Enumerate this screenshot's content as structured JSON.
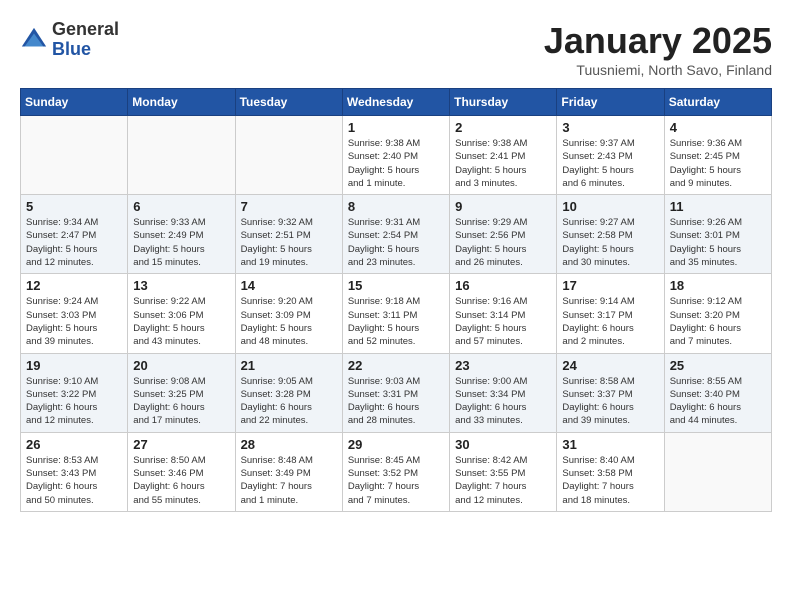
{
  "logo": {
    "general": "General",
    "blue": "Blue"
  },
  "title": "January 2025",
  "subtitle": "Tuusniemi, North Savo, Finland",
  "weekdays": [
    "Sunday",
    "Monday",
    "Tuesday",
    "Wednesday",
    "Thursday",
    "Friday",
    "Saturday"
  ],
  "weeks": [
    [
      {
        "day": "",
        "info": ""
      },
      {
        "day": "",
        "info": ""
      },
      {
        "day": "",
        "info": ""
      },
      {
        "day": "1",
        "info": "Sunrise: 9:38 AM\nSunset: 2:40 PM\nDaylight: 5 hours\nand 1 minute."
      },
      {
        "day": "2",
        "info": "Sunrise: 9:38 AM\nSunset: 2:41 PM\nDaylight: 5 hours\nand 3 minutes."
      },
      {
        "day": "3",
        "info": "Sunrise: 9:37 AM\nSunset: 2:43 PM\nDaylight: 5 hours\nand 6 minutes."
      },
      {
        "day": "4",
        "info": "Sunrise: 9:36 AM\nSunset: 2:45 PM\nDaylight: 5 hours\nand 9 minutes."
      }
    ],
    [
      {
        "day": "5",
        "info": "Sunrise: 9:34 AM\nSunset: 2:47 PM\nDaylight: 5 hours\nand 12 minutes."
      },
      {
        "day": "6",
        "info": "Sunrise: 9:33 AM\nSunset: 2:49 PM\nDaylight: 5 hours\nand 15 minutes."
      },
      {
        "day": "7",
        "info": "Sunrise: 9:32 AM\nSunset: 2:51 PM\nDaylight: 5 hours\nand 19 minutes."
      },
      {
        "day": "8",
        "info": "Sunrise: 9:31 AM\nSunset: 2:54 PM\nDaylight: 5 hours\nand 23 minutes."
      },
      {
        "day": "9",
        "info": "Sunrise: 9:29 AM\nSunset: 2:56 PM\nDaylight: 5 hours\nand 26 minutes."
      },
      {
        "day": "10",
        "info": "Sunrise: 9:27 AM\nSunset: 2:58 PM\nDaylight: 5 hours\nand 30 minutes."
      },
      {
        "day": "11",
        "info": "Sunrise: 9:26 AM\nSunset: 3:01 PM\nDaylight: 5 hours\nand 35 minutes."
      }
    ],
    [
      {
        "day": "12",
        "info": "Sunrise: 9:24 AM\nSunset: 3:03 PM\nDaylight: 5 hours\nand 39 minutes."
      },
      {
        "day": "13",
        "info": "Sunrise: 9:22 AM\nSunset: 3:06 PM\nDaylight: 5 hours\nand 43 minutes."
      },
      {
        "day": "14",
        "info": "Sunrise: 9:20 AM\nSunset: 3:09 PM\nDaylight: 5 hours\nand 48 minutes."
      },
      {
        "day": "15",
        "info": "Sunrise: 9:18 AM\nSunset: 3:11 PM\nDaylight: 5 hours\nand 52 minutes."
      },
      {
        "day": "16",
        "info": "Sunrise: 9:16 AM\nSunset: 3:14 PM\nDaylight: 5 hours\nand 57 minutes."
      },
      {
        "day": "17",
        "info": "Sunrise: 9:14 AM\nSunset: 3:17 PM\nDaylight: 6 hours\nand 2 minutes."
      },
      {
        "day": "18",
        "info": "Sunrise: 9:12 AM\nSunset: 3:20 PM\nDaylight: 6 hours\nand 7 minutes."
      }
    ],
    [
      {
        "day": "19",
        "info": "Sunrise: 9:10 AM\nSunset: 3:22 PM\nDaylight: 6 hours\nand 12 minutes."
      },
      {
        "day": "20",
        "info": "Sunrise: 9:08 AM\nSunset: 3:25 PM\nDaylight: 6 hours\nand 17 minutes."
      },
      {
        "day": "21",
        "info": "Sunrise: 9:05 AM\nSunset: 3:28 PM\nDaylight: 6 hours\nand 22 minutes."
      },
      {
        "day": "22",
        "info": "Sunrise: 9:03 AM\nSunset: 3:31 PM\nDaylight: 6 hours\nand 28 minutes."
      },
      {
        "day": "23",
        "info": "Sunrise: 9:00 AM\nSunset: 3:34 PM\nDaylight: 6 hours\nand 33 minutes."
      },
      {
        "day": "24",
        "info": "Sunrise: 8:58 AM\nSunset: 3:37 PM\nDaylight: 6 hours\nand 39 minutes."
      },
      {
        "day": "25",
        "info": "Sunrise: 8:55 AM\nSunset: 3:40 PM\nDaylight: 6 hours\nand 44 minutes."
      }
    ],
    [
      {
        "day": "26",
        "info": "Sunrise: 8:53 AM\nSunset: 3:43 PM\nDaylight: 6 hours\nand 50 minutes."
      },
      {
        "day": "27",
        "info": "Sunrise: 8:50 AM\nSunset: 3:46 PM\nDaylight: 6 hours\nand 55 minutes."
      },
      {
        "day": "28",
        "info": "Sunrise: 8:48 AM\nSunset: 3:49 PM\nDaylight: 7 hours\nand 1 minute."
      },
      {
        "day": "29",
        "info": "Sunrise: 8:45 AM\nSunset: 3:52 PM\nDaylight: 7 hours\nand 7 minutes."
      },
      {
        "day": "30",
        "info": "Sunrise: 8:42 AM\nSunset: 3:55 PM\nDaylight: 7 hours\nand 12 minutes."
      },
      {
        "day": "31",
        "info": "Sunrise: 8:40 AM\nSunset: 3:58 PM\nDaylight: 7 hours\nand 18 minutes."
      },
      {
        "day": "",
        "info": ""
      }
    ]
  ]
}
